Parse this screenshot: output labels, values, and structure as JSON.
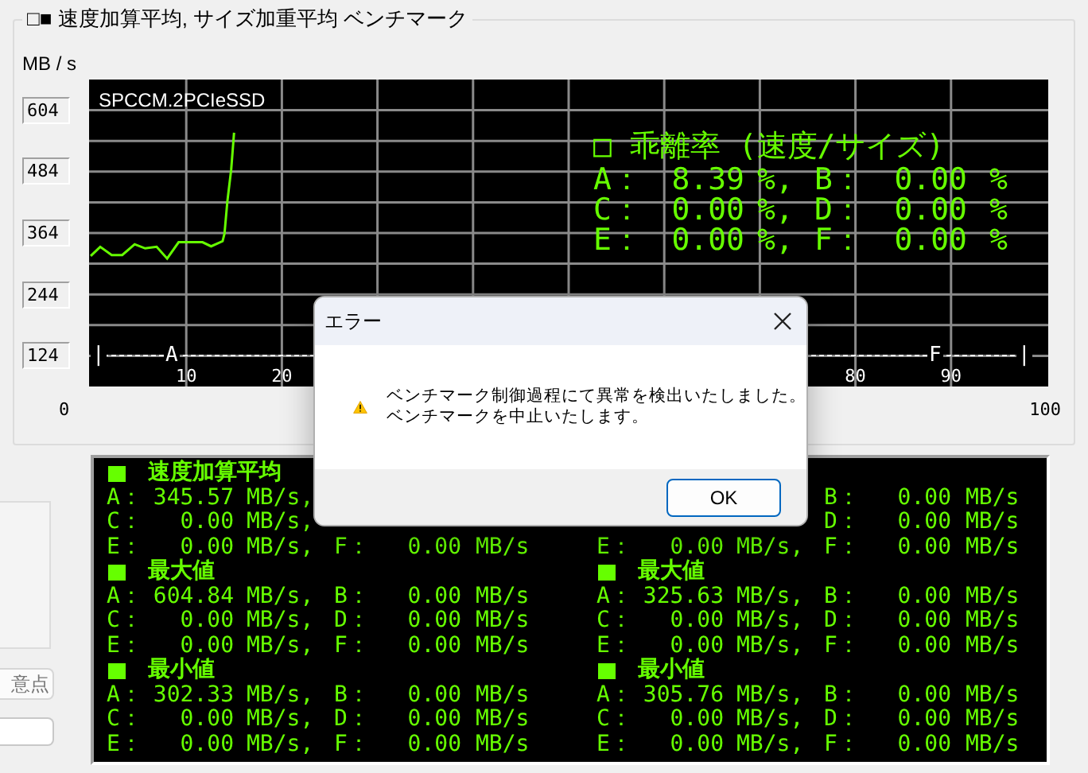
{
  "group": {
    "title": "□■ 速度加算平均, サイズ加重平均 ベンチマーク"
  },
  "chart": {
    "unit": "MB / s",
    "device": "SPCCM.2PCIeSSD",
    "chart_data": {
      "type": "line",
      "x": [
        0,
        1,
        2.2,
        3.3,
        4.6,
        5.7,
        6.9,
        8,
        9.2,
        11.7,
        12.6,
        13.8,
        14,
        14.3,
        14.7,
        15
      ],
      "series": [
        {
          "color": "#66ff00",
          "values": [
            319,
            337,
            321,
            321,
            342,
            334,
            337,
            314,
            346,
            346,
            338,
            348,
            363,
            426,
            488,
            560
          ]
        }
      ],
      "xlim": [
        0,
        100
      ],
      "ylim": [
        64,
        664
      ],
      "xticks": [
        {
          "value": 10,
          "label": "10"
        },
        {
          "value": 20,
          "label": "20"
        },
        {
          "value": 80,
          "label": "80"
        },
        {
          "value": 90,
          "label": "90"
        }
      ],
      "yticks": [
        {
          "value": 604,
          "label": "604"
        },
        {
          "value": 484,
          "label": "484"
        },
        {
          "value": 364,
          "label": "364"
        },
        {
          "value": 244,
          "label": "244"
        },
        {
          "value": 124,
          "label": "124"
        }
      ],
      "grid": true,
      "ref_lines": [
        {
          "axis": "y",
          "value": 125
        }
      ]
    },
    "range_markers": [
      "|",
      "A",
      "F",
      "|"
    ],
    "range_start": "0",
    "range_end": "100",
    "deviation": {
      "title": "□ 乖離率 (速度/サイズ)",
      "rows": [
        {
          "cells": [
            "A：",
            "8.39",
            "%,",
            "B：",
            "0.00",
            "%"
          ]
        },
        {
          "cells": [
            "C：",
            "0.00",
            "%,",
            "D：",
            "0.00",
            "%"
          ]
        },
        {
          "cells": [
            "E：",
            "0.00",
            "%,",
            "F：",
            "0.00",
            "%"
          ]
        }
      ]
    }
  },
  "side": {
    "button": "意点"
  },
  "results": {
    "columns": [
      {
        "sections": [
          {
            "title": "速度加算平均",
            "rows": [
              {
                "first": [
                  "A：",
                  "345.57",
                  "MB/s,"
                ]
              },
              {
                "first": [
                  "C：",
                  "0.00",
                  "MB/s,"
                ]
              },
              {
                "first": [
                  "E：",
                  "0.00",
                  "MB/s,"
                ],
                "second": [
                  "F：",
                  "0.00",
                  "MB/s"
                ]
              }
            ]
          },
          {
            "title": "最大値",
            "rows": [
              {
                "first": [
                  "A：",
                  "604.84",
                  "MB/s,"
                ],
                "second": [
                  "B：",
                  "0.00",
                  "MB/s"
                ]
              },
              {
                "first": [
                  "C：",
                  "0.00",
                  "MB/s,"
                ],
                "second": [
                  "D：",
                  "0.00",
                  "MB/s"
                ]
              },
              {
                "first": [
                  "E：",
                  "0.00",
                  "MB/s,"
                ],
                "second": [
                  "F：",
                  "0.00",
                  "MB/s"
                ]
              }
            ]
          },
          {
            "title": "最小値",
            "rows": [
              {
                "first": [
                  "A：",
                  "302.33",
                  "MB/s,"
                ],
                "second": [
                  "B：",
                  "0.00",
                  "MB/s"
                ]
              },
              {
                "first": [
                  "C：",
                  "0.00",
                  "MB/s,"
                ],
                "second": [
                  "D：",
                  "0.00",
                  "MB/s"
                ]
              },
              {
                "first": [
                  "E：",
                  "0.00",
                  "MB/s,"
                ],
                "second": [
                  "F：",
                  "0.00",
                  "MB/s"
                ]
              }
            ]
          }
        ]
      },
      {
        "sections": [
          {
            "rows": [
              {
                "second": [
                  "B：",
                  "0.00",
                  "MB/s"
                ]
              },
              {
                "second": [
                  "D：",
                  "0.00",
                  "MB/s"
                ]
              },
              {
                "first": [
                  "E：",
                  "0.00",
                  "MB/s,"
                ],
                "second": [
                  "F：",
                  "0.00",
                  "MB/s"
                ]
              }
            ]
          },
          {
            "title": "最大値",
            "rows": [
              {
                "first": [
                  "A：",
                  "325.63",
                  "MB/s,"
                ],
                "second": [
                  "B：",
                  "0.00",
                  "MB/s"
                ]
              },
              {
                "first": [
                  "C：",
                  "0.00",
                  "MB/s,"
                ],
                "second": [
                  "D：",
                  "0.00",
                  "MB/s"
                ]
              },
              {
                "first": [
                  "E：",
                  "0.00",
                  "MB/s,"
                ],
                "second": [
                  "F：",
                  "0.00",
                  "MB/s"
                ]
              }
            ]
          },
          {
            "title": "最小値",
            "rows": [
              {
                "first": [
                  "A：",
                  "305.76",
                  "MB/s,"
                ],
                "second": [
                  "B：",
                  "0.00",
                  "MB/s"
                ]
              },
              {
                "first": [
                  "C：",
                  "0.00",
                  "MB/s,"
                ],
                "second": [
                  "D：",
                  "0.00",
                  "MB/s"
                ]
              },
              {
                "first": [
                  "E：",
                  "0.00",
                  "MB/s,"
                ],
                "second": [
                  "F：",
                  "0.00",
                  "MB/s"
                ]
              }
            ]
          }
        ]
      }
    ]
  },
  "dialog": {
    "title": "エラー",
    "message": [
      "ベンチマーク制御過程にて異常を検出いたしました。",
      "ベンチマークを中止いたします。"
    ],
    "button": "OK"
  }
}
